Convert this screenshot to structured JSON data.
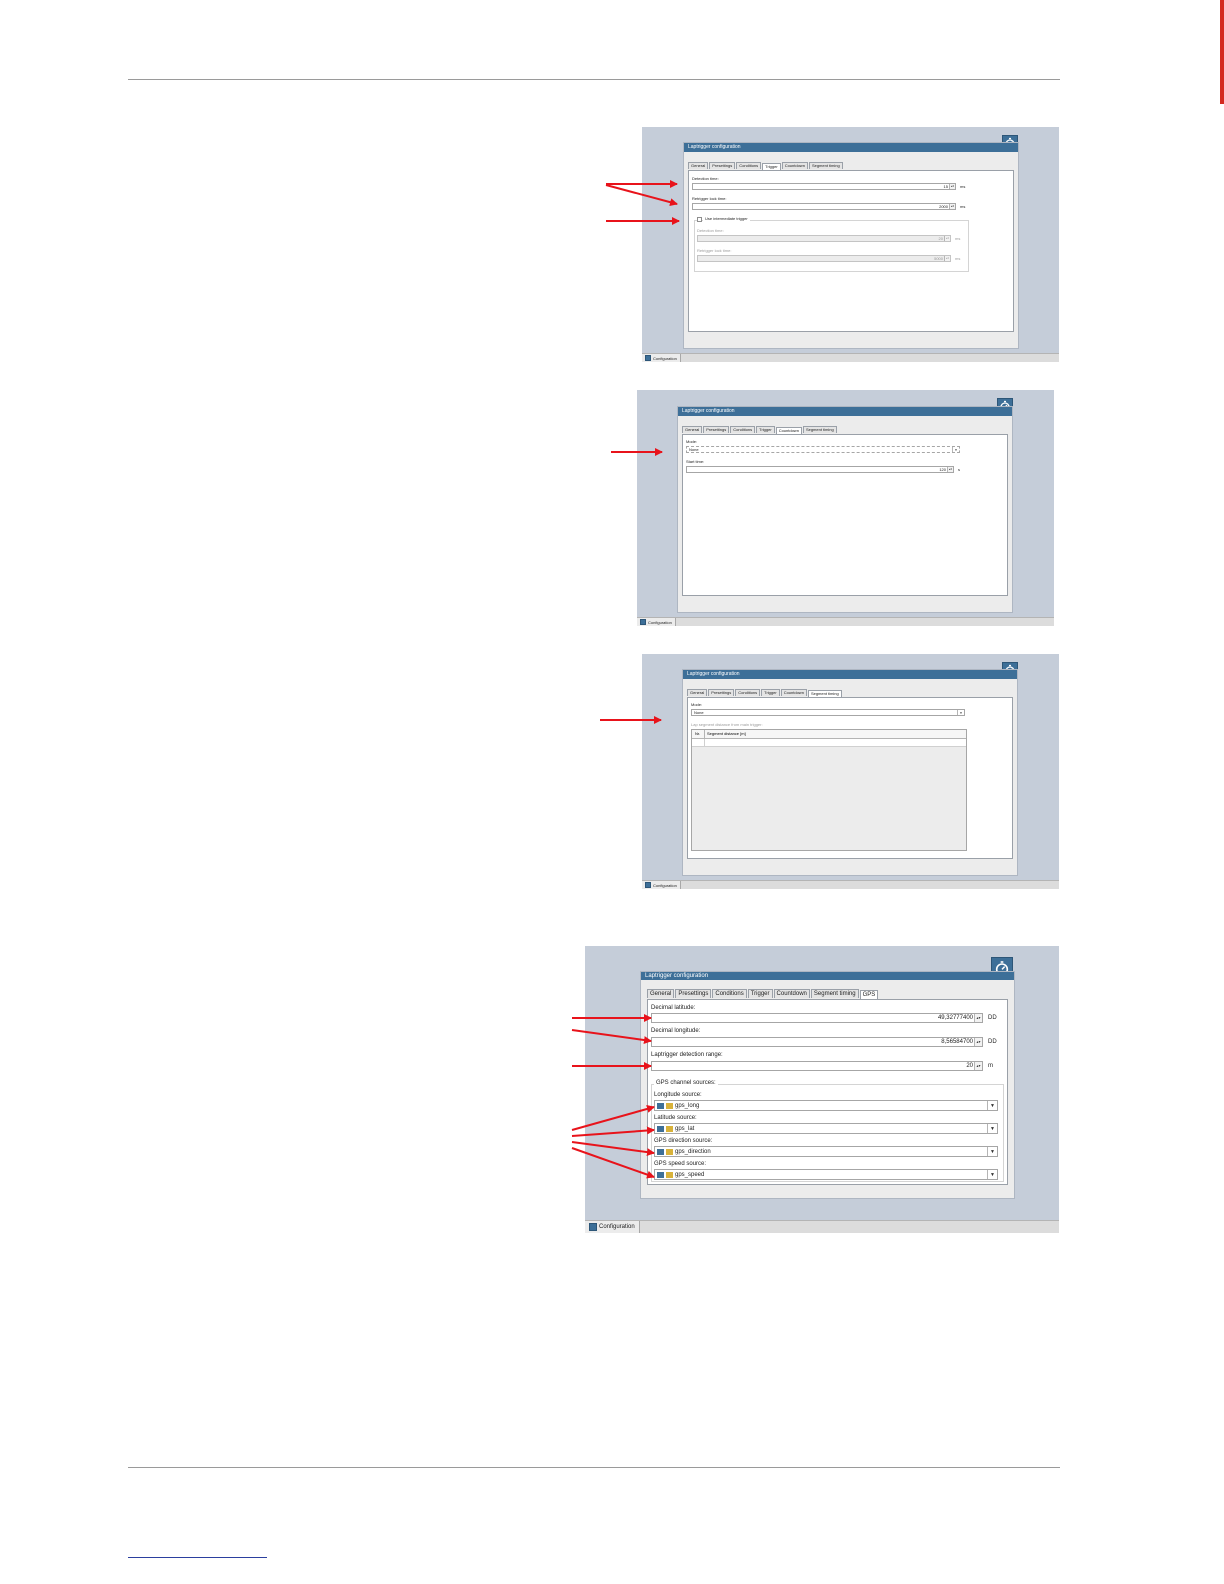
{
  "window_title": "Laptrigger configuration",
  "tabs_base": [
    "General",
    "Presettings",
    "Conditions",
    "Trigger",
    "Countdown",
    "Segment timing"
  ],
  "tabs_gps": [
    "General",
    "Presettings",
    "Conditions",
    "Trigger",
    "Countdown",
    "Segment timing",
    "GPS"
  ],
  "statusbar_tab": "Configuration",
  "trigger": {
    "detection_time_label": "Detection time:",
    "detection_time_value": "15",
    "retrigger_lock_label": "Retrigger lock time:",
    "retrigger_lock_value": "2000",
    "unit_ms": "ms",
    "intermediate_label": "Use intermediate trigger",
    "inter_detection_label": "Detection time:",
    "inter_detection_value": "20",
    "inter_retrigger_label": "Retrigger lock time:",
    "inter_retrigger_value": "5000"
  },
  "countdown": {
    "mode_label": "Mode:",
    "mode_value": "None",
    "start_time_label": "Start time:",
    "start_time_value": "120",
    "unit_s": "s"
  },
  "segment": {
    "mode_label": "Mode:",
    "mode_value": "None",
    "distance_label": "Lap segment distance from main trigger:",
    "col_nr": "Nr.",
    "col_distance": "Segment distance [m]"
  },
  "gps": {
    "lat_label": "Decimal latitude:",
    "lat_value": "49,32777400",
    "lon_label": "Decimal longitude:",
    "lon_value": "8,56584700",
    "unit_dd": "DD",
    "range_label": "Laptrigger detection range:",
    "range_value": "20",
    "unit_m": "m",
    "group_label": "GPS channel sources:",
    "long_src_label": "Longitude source:",
    "long_src_value": "gps_long",
    "lat_src_label": "Latitude source:",
    "lat_src_value": "gps_lat",
    "dir_src_label": "GPS direction source:",
    "dir_src_value": "gps_direction",
    "speed_src_label": "GPS speed source:",
    "speed_src_value": "gps_speed"
  },
  "colors": {
    "annotation_arrow": "#e8131b",
    "titlebar": "#3d6f98",
    "background": "#c5cdd9"
  }
}
